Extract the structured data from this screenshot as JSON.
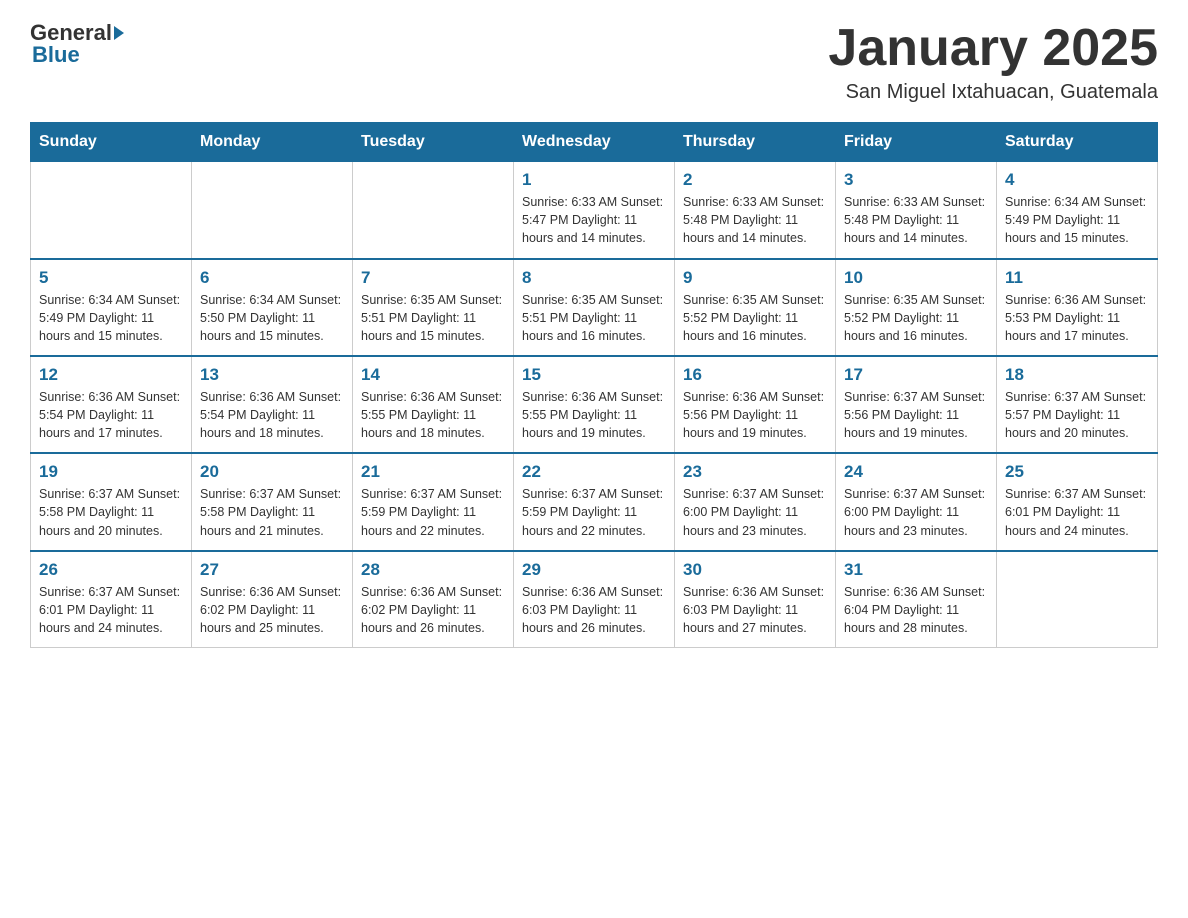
{
  "header": {
    "logo": {
      "general": "General",
      "blue": "Blue"
    },
    "title": "January 2025",
    "subtitle": "San Miguel Ixtahuacan, Guatemala"
  },
  "days_of_week": [
    "Sunday",
    "Monday",
    "Tuesday",
    "Wednesday",
    "Thursday",
    "Friday",
    "Saturday"
  ],
  "weeks": [
    [
      {
        "day": "",
        "info": ""
      },
      {
        "day": "",
        "info": ""
      },
      {
        "day": "",
        "info": ""
      },
      {
        "day": "1",
        "info": "Sunrise: 6:33 AM\nSunset: 5:47 PM\nDaylight: 11 hours and 14 minutes."
      },
      {
        "day": "2",
        "info": "Sunrise: 6:33 AM\nSunset: 5:48 PM\nDaylight: 11 hours and 14 minutes."
      },
      {
        "day": "3",
        "info": "Sunrise: 6:33 AM\nSunset: 5:48 PM\nDaylight: 11 hours and 14 minutes."
      },
      {
        "day": "4",
        "info": "Sunrise: 6:34 AM\nSunset: 5:49 PM\nDaylight: 11 hours and 15 minutes."
      }
    ],
    [
      {
        "day": "5",
        "info": "Sunrise: 6:34 AM\nSunset: 5:49 PM\nDaylight: 11 hours and 15 minutes."
      },
      {
        "day": "6",
        "info": "Sunrise: 6:34 AM\nSunset: 5:50 PM\nDaylight: 11 hours and 15 minutes."
      },
      {
        "day": "7",
        "info": "Sunrise: 6:35 AM\nSunset: 5:51 PM\nDaylight: 11 hours and 15 minutes."
      },
      {
        "day": "8",
        "info": "Sunrise: 6:35 AM\nSunset: 5:51 PM\nDaylight: 11 hours and 16 minutes."
      },
      {
        "day": "9",
        "info": "Sunrise: 6:35 AM\nSunset: 5:52 PM\nDaylight: 11 hours and 16 minutes."
      },
      {
        "day": "10",
        "info": "Sunrise: 6:35 AM\nSunset: 5:52 PM\nDaylight: 11 hours and 16 minutes."
      },
      {
        "day": "11",
        "info": "Sunrise: 6:36 AM\nSunset: 5:53 PM\nDaylight: 11 hours and 17 minutes."
      }
    ],
    [
      {
        "day": "12",
        "info": "Sunrise: 6:36 AM\nSunset: 5:54 PM\nDaylight: 11 hours and 17 minutes."
      },
      {
        "day": "13",
        "info": "Sunrise: 6:36 AM\nSunset: 5:54 PM\nDaylight: 11 hours and 18 minutes."
      },
      {
        "day": "14",
        "info": "Sunrise: 6:36 AM\nSunset: 5:55 PM\nDaylight: 11 hours and 18 minutes."
      },
      {
        "day": "15",
        "info": "Sunrise: 6:36 AM\nSunset: 5:55 PM\nDaylight: 11 hours and 19 minutes."
      },
      {
        "day": "16",
        "info": "Sunrise: 6:36 AM\nSunset: 5:56 PM\nDaylight: 11 hours and 19 minutes."
      },
      {
        "day": "17",
        "info": "Sunrise: 6:37 AM\nSunset: 5:56 PM\nDaylight: 11 hours and 19 minutes."
      },
      {
        "day": "18",
        "info": "Sunrise: 6:37 AM\nSunset: 5:57 PM\nDaylight: 11 hours and 20 minutes."
      }
    ],
    [
      {
        "day": "19",
        "info": "Sunrise: 6:37 AM\nSunset: 5:58 PM\nDaylight: 11 hours and 20 minutes."
      },
      {
        "day": "20",
        "info": "Sunrise: 6:37 AM\nSunset: 5:58 PM\nDaylight: 11 hours and 21 minutes."
      },
      {
        "day": "21",
        "info": "Sunrise: 6:37 AM\nSunset: 5:59 PM\nDaylight: 11 hours and 22 minutes."
      },
      {
        "day": "22",
        "info": "Sunrise: 6:37 AM\nSunset: 5:59 PM\nDaylight: 11 hours and 22 minutes."
      },
      {
        "day": "23",
        "info": "Sunrise: 6:37 AM\nSunset: 6:00 PM\nDaylight: 11 hours and 23 minutes."
      },
      {
        "day": "24",
        "info": "Sunrise: 6:37 AM\nSunset: 6:00 PM\nDaylight: 11 hours and 23 minutes."
      },
      {
        "day": "25",
        "info": "Sunrise: 6:37 AM\nSunset: 6:01 PM\nDaylight: 11 hours and 24 minutes."
      }
    ],
    [
      {
        "day": "26",
        "info": "Sunrise: 6:37 AM\nSunset: 6:01 PM\nDaylight: 11 hours and 24 minutes."
      },
      {
        "day": "27",
        "info": "Sunrise: 6:36 AM\nSunset: 6:02 PM\nDaylight: 11 hours and 25 minutes."
      },
      {
        "day": "28",
        "info": "Sunrise: 6:36 AM\nSunset: 6:02 PM\nDaylight: 11 hours and 26 minutes."
      },
      {
        "day": "29",
        "info": "Sunrise: 6:36 AM\nSunset: 6:03 PM\nDaylight: 11 hours and 26 minutes."
      },
      {
        "day": "30",
        "info": "Sunrise: 6:36 AM\nSunset: 6:03 PM\nDaylight: 11 hours and 27 minutes."
      },
      {
        "day": "31",
        "info": "Sunrise: 6:36 AM\nSunset: 6:04 PM\nDaylight: 11 hours and 28 minutes."
      },
      {
        "day": "",
        "info": ""
      }
    ]
  ]
}
